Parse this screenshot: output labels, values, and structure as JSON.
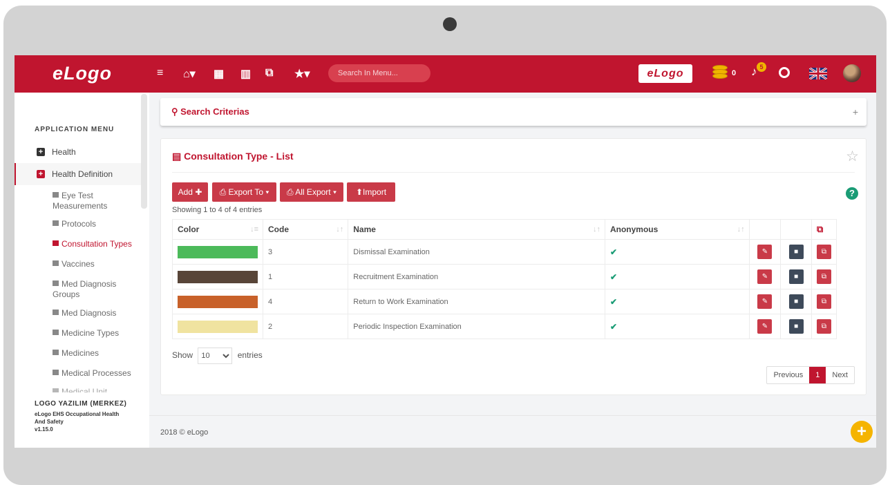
{
  "header": {
    "brand": "eLogo",
    "search_placeholder": "Search In Menu...",
    "logo_chip": "eLogo",
    "coins": "0",
    "notifications": "5"
  },
  "sidebar": {
    "title": "APPLICATION MENU",
    "items": [
      {
        "label": "Health",
        "icon": "plus-square-icon"
      },
      {
        "label": "Health Definition",
        "icon": "plus-square-icon"
      }
    ],
    "sub_items": [
      {
        "label": "Eye Test Measurements"
      },
      {
        "label": "Protocols"
      },
      {
        "label": "Consultation Types"
      },
      {
        "label": "Vaccines"
      },
      {
        "label": "Med Diagnosis Groups"
      },
      {
        "label": "Med Diagnosis"
      },
      {
        "label": "Medicine Types"
      },
      {
        "label": "Medicines"
      },
      {
        "label": "Medical Processes"
      },
      {
        "label": "Medical Unit Groups"
      }
    ],
    "company": "LOGO YAZILIM (MERKEZ)",
    "product": "eLogo EHS Occupational Health And Safety",
    "version": "v1.15.0"
  },
  "search_panel": {
    "title": "Search Criterias"
  },
  "list_panel": {
    "title": "Consultation Type - List",
    "buttons": {
      "add": "Add",
      "export_to": "Export To",
      "all_export": "All Export",
      "import": "Import"
    },
    "info": "Showing 1 to 4 of 4 entries",
    "columns": [
      "Color",
      "Code",
      "Name",
      "Anonymous"
    ],
    "rows": [
      {
        "color": "#4cba5a",
        "code": "3",
        "name": "Dismissal Examination"
      },
      {
        "color": "#584538",
        "code": "1",
        "name": "Recruitment Examination"
      },
      {
        "color": "#c8612a",
        "code": "4",
        "name": "Return to Work Examination"
      },
      {
        "color": "#f0e3a0",
        "code": "2",
        "name": "Periodic Inspection Examination"
      }
    ],
    "show_label": "Show",
    "entries_label": "entries",
    "page_size": "10",
    "pagination": {
      "previous": "Previous",
      "current": "1",
      "next": "Next"
    }
  },
  "footer": {
    "copyright": "2018 © eLogo"
  },
  "colors": {
    "accent": "#c0152f",
    "check": "#1a9c75"
  }
}
